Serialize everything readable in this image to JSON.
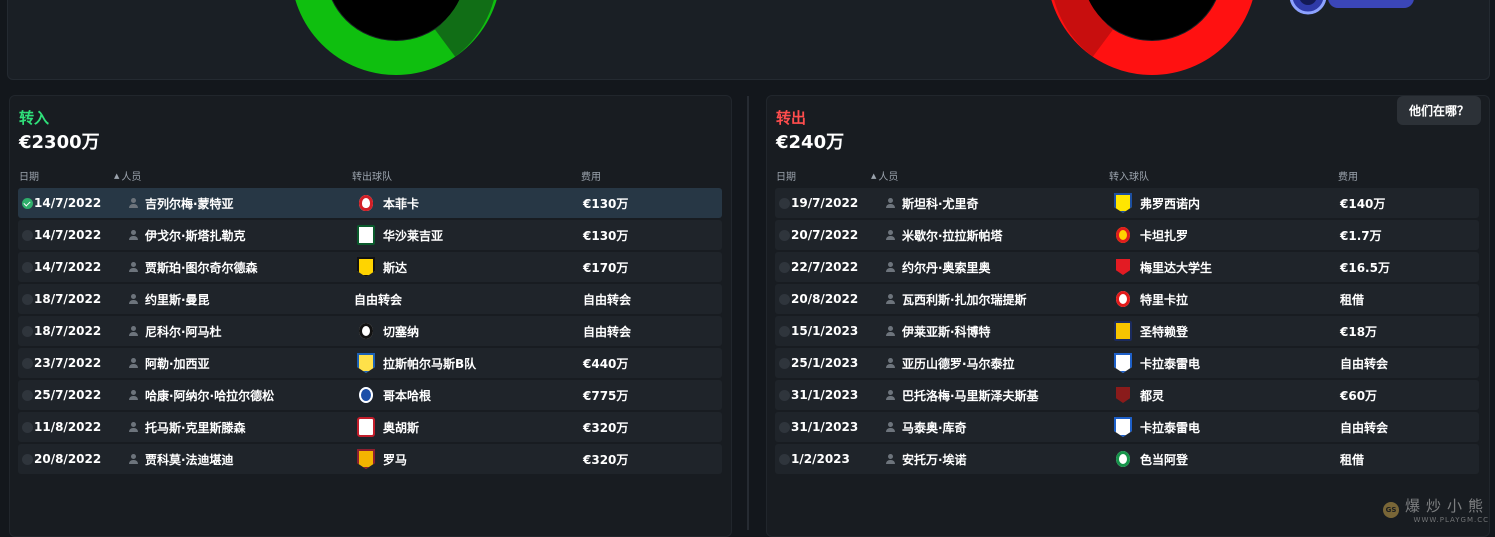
{
  "incoming": {
    "title": "转入",
    "total": "€2300万",
    "color": "#2fe07a",
    "headers": {
      "date": "日期",
      "person": "人员",
      "club": "转出球队",
      "fee": "费用"
    },
    "rows": [
      {
        "date": "14/7/2022",
        "name": "吉列尔梅·蒙特亚",
        "club": "本菲卡",
        "fee": "€130万",
        "crest": "benfica-crest",
        "selected": true
      },
      {
        "date": "14/7/2022",
        "name": "伊戈尔·斯塔扎勒克",
        "club": "华沙莱吉亚",
        "fee": "€130万",
        "crest": "legia-crest"
      },
      {
        "date": "14/7/2022",
        "name": "贾斯珀·图尔奇尔德森",
        "club": "斯达",
        "fee": "€170万",
        "crest": "lierse-crest"
      },
      {
        "date": "18/7/2022",
        "name": "约里斯·曼昆",
        "club": "自由转会",
        "fee": "自由转会",
        "crest": ""
      },
      {
        "date": "18/7/2022",
        "name": "尼科尔·阿马杜",
        "club": "切塞纳",
        "fee": "自由转会",
        "crest": "cesena-crest"
      },
      {
        "date": "23/7/2022",
        "name": "阿勒·加西亚",
        "club": "拉斯帕尔马斯B队",
        "fee": "€440万",
        "crest": "laspalmas-crest"
      },
      {
        "date": "25/7/2022",
        "name": "哈康·阿纳尔·哈拉尔德松",
        "club": "哥本哈根",
        "fee": "€775万",
        "crest": "copenhagen-crest"
      },
      {
        "date": "11/8/2022",
        "name": "托马斯·克里斯滕森",
        "club": "奥胡斯",
        "fee": "€320万",
        "crest": "aarhus-crest"
      },
      {
        "date": "20/8/2022",
        "name": "贾科莫·法迪堪迪",
        "club": "罗马",
        "fee": "€320万",
        "crest": "roma-crest"
      }
    ]
  },
  "outgoing": {
    "title": "转出",
    "total": "€240万",
    "color": "#ff4d4d",
    "where_button": "他们在哪？",
    "headers": {
      "date": "日期",
      "person": "人员",
      "club": "转入球队",
      "fee": "费用"
    },
    "rows": [
      {
        "date": "19/7/2022",
        "name": "斯坦科·尤里奇",
        "club": "弗罗西诺内",
        "fee": "€140万",
        "crest": "frosinone-crest"
      },
      {
        "date": "20/7/2022",
        "name": "米歇尔·拉拉斯帕塔",
        "club": "卡坦扎罗",
        "fee": "€1.7万",
        "crest": "catanzaro-crest"
      },
      {
        "date": "22/7/2022",
        "name": "约尔丹·奥索里奥",
        "club": "梅里达大学生",
        "fee": "€16.5万",
        "crest": "merida-crest"
      },
      {
        "date": "20/8/2022",
        "name": "瓦西利斯·扎加尔瑞提斯",
        "club": "特里卡拉",
        "fee": "租借",
        "crest": "trikala-crest"
      },
      {
        "date": "15/1/2023",
        "name": "伊莱亚斯·科博特",
        "club": "圣特赖登",
        "fee": "€18万",
        "crest": "stvv-crest"
      },
      {
        "date": "25/1/2023",
        "name": "亚历山德罗·马尔泰拉",
        "club": "卡拉泰雷电",
        "fee": "自由转会",
        "crest": "carrarese-crest"
      },
      {
        "date": "31/1/2023",
        "name": "巴托洛梅·马里斯泽夫斯基",
        "club": "都灵",
        "fee": "€60万",
        "crest": "torino-crest"
      },
      {
        "date": "31/1/2023",
        "name": "马泰奥·库奇",
        "club": "卡拉泰雷电",
        "fee": "自由转会",
        "crest": "carrarese-crest"
      },
      {
        "date": "1/2/2023",
        "name": "安托万·埃诺",
        "club": "色当阿登",
        "fee": "租借",
        "crest": "sedan-crest"
      }
    ]
  },
  "watermark": {
    "cn": "爆炒小熊",
    "en": "WWW.PLAYGM.CC",
    "logo": "GS"
  },
  "colors": {
    "green_donut": "#0fbf0f",
    "green_dark": "#116e16",
    "red_donut": "#ff1111",
    "red_dark": "#c80e0e"
  }
}
